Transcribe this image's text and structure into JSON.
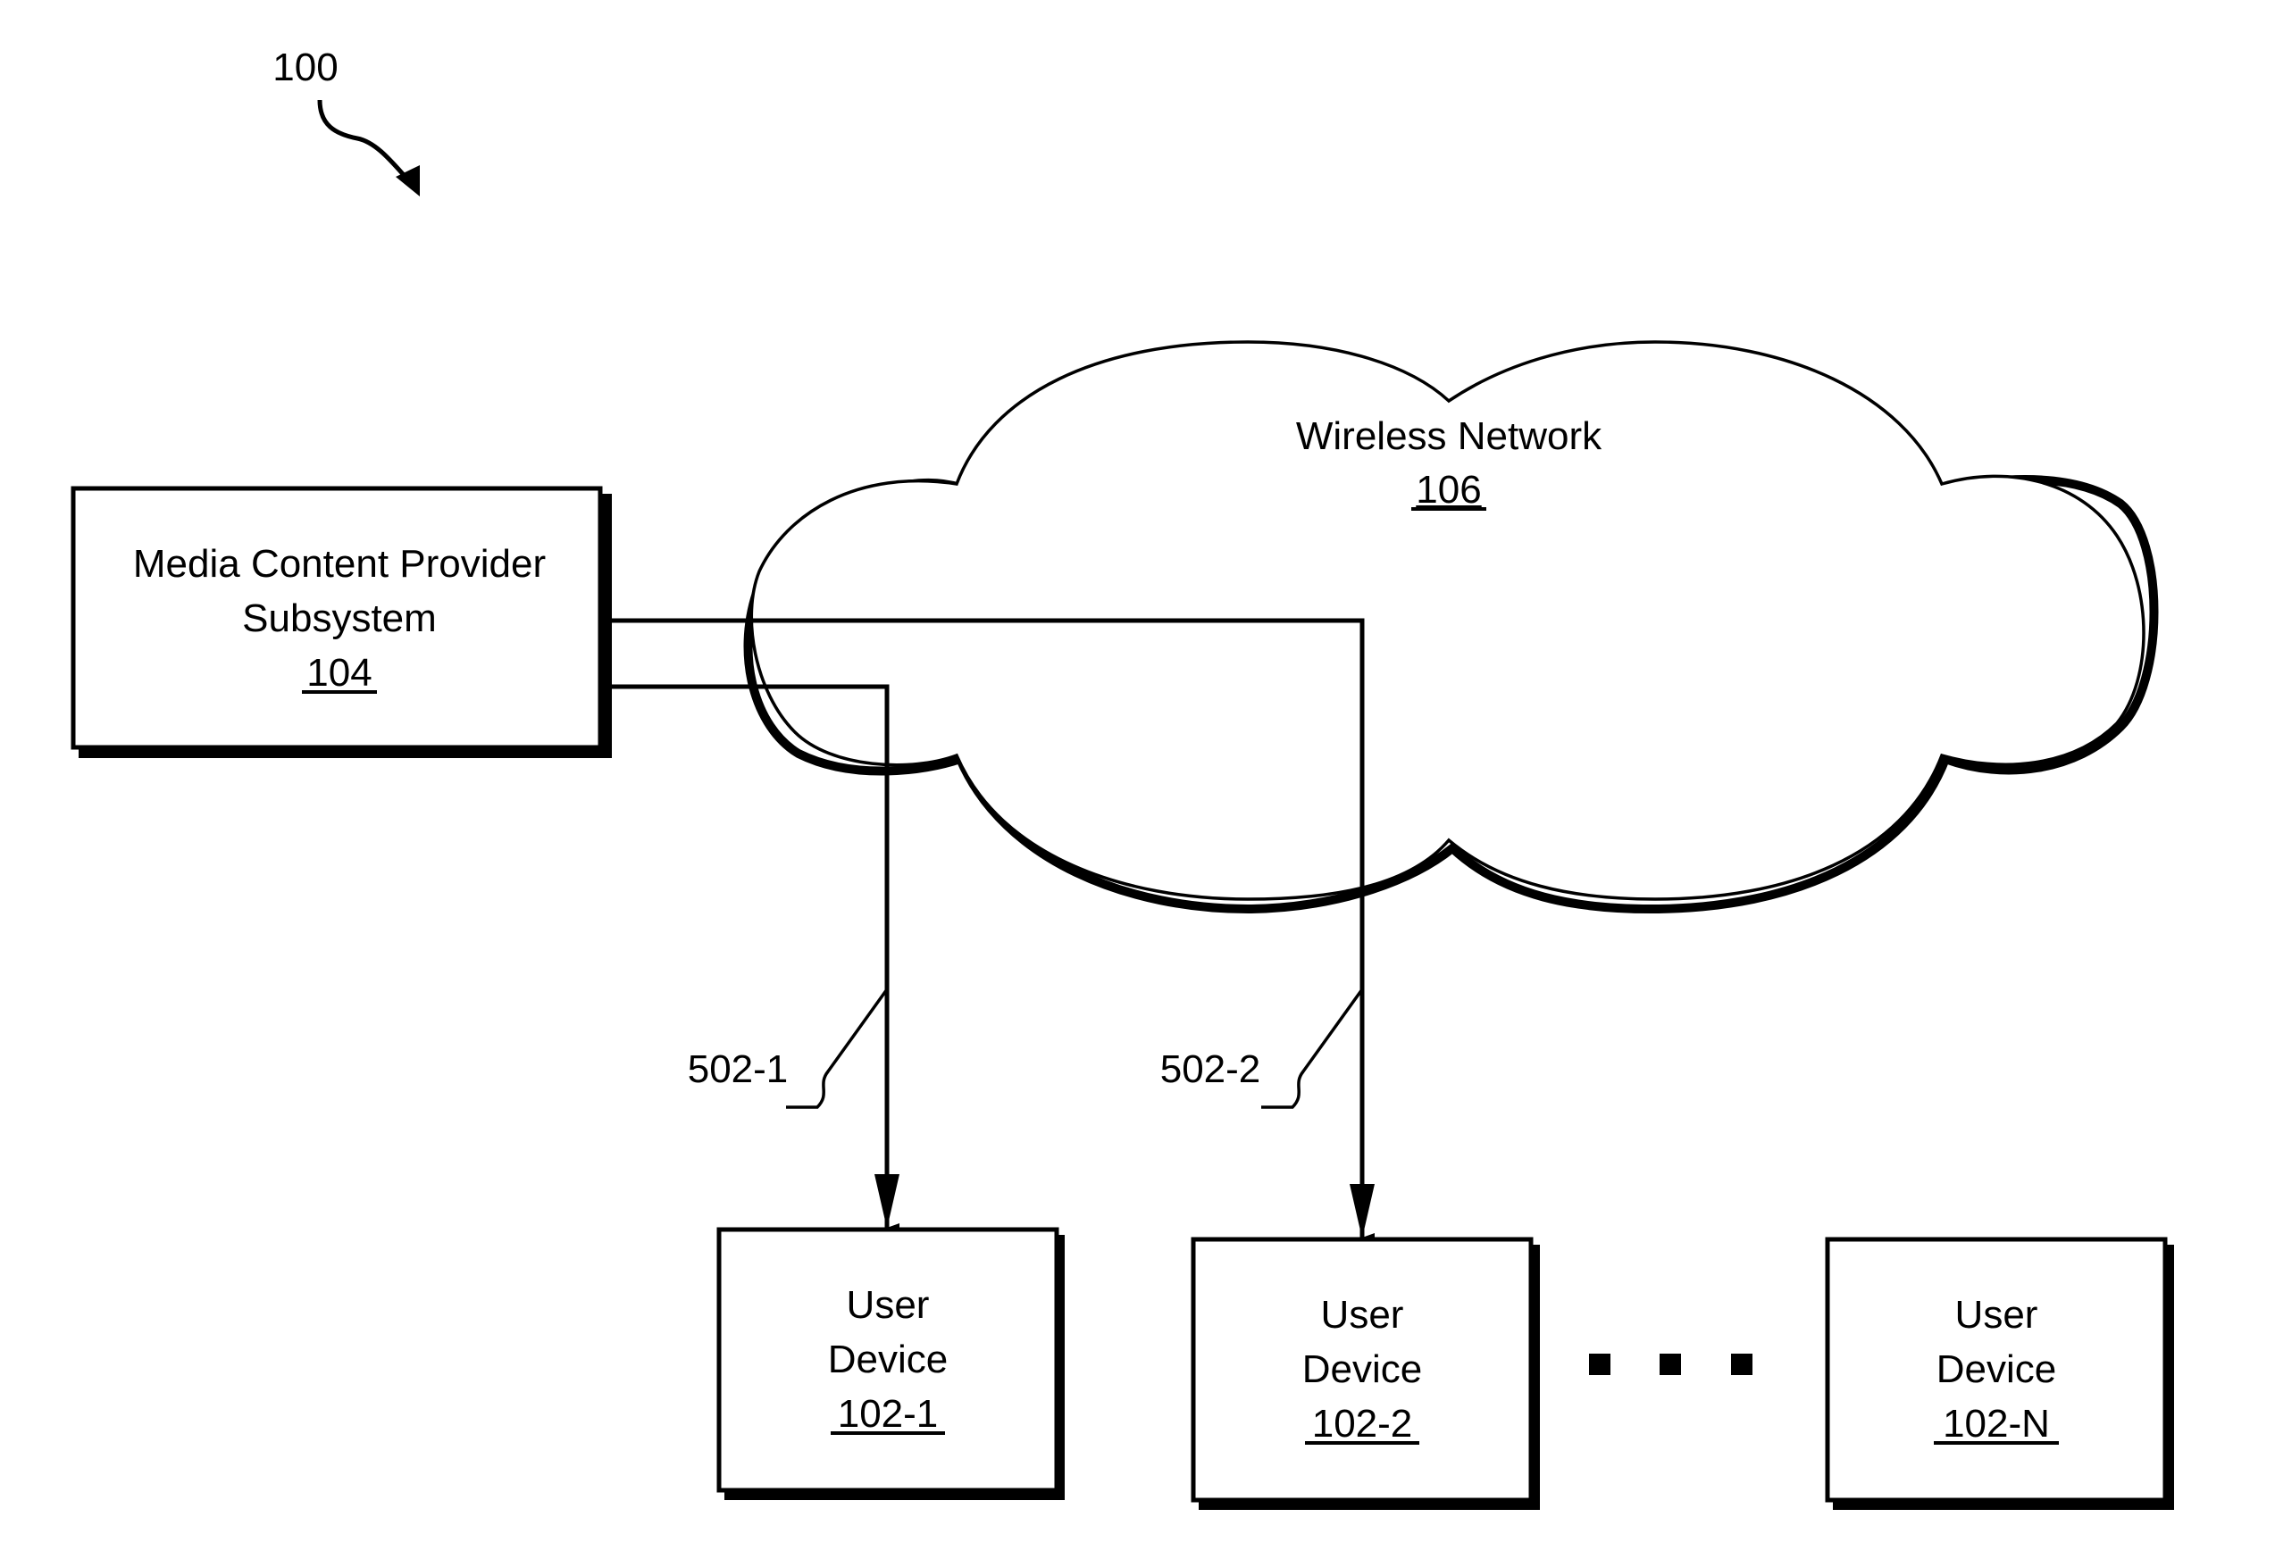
{
  "figure": {
    "ref": "100",
    "colors": {
      "ink": "#000000",
      "background": "#ffffff"
    }
  },
  "network": {
    "title": "Wireless Network",
    "ref": "106"
  },
  "provider": {
    "line1": "Media Content Provider",
    "line2": "Subsystem",
    "ref": "104"
  },
  "connections": [
    {
      "ref": "502-1",
      "from": "104",
      "to": "102-1"
    },
    {
      "ref": "502-2",
      "from": "104",
      "to": "102-2"
    }
  ],
  "devices": [
    {
      "line1": "User",
      "line2": "Device",
      "ref": "102-1"
    },
    {
      "line1": "User",
      "line2": "Device",
      "ref": "102-2"
    },
    {
      "line1": "User",
      "line2": "Device",
      "ref": "102-N"
    }
  ],
  "ellipsis": "..."
}
